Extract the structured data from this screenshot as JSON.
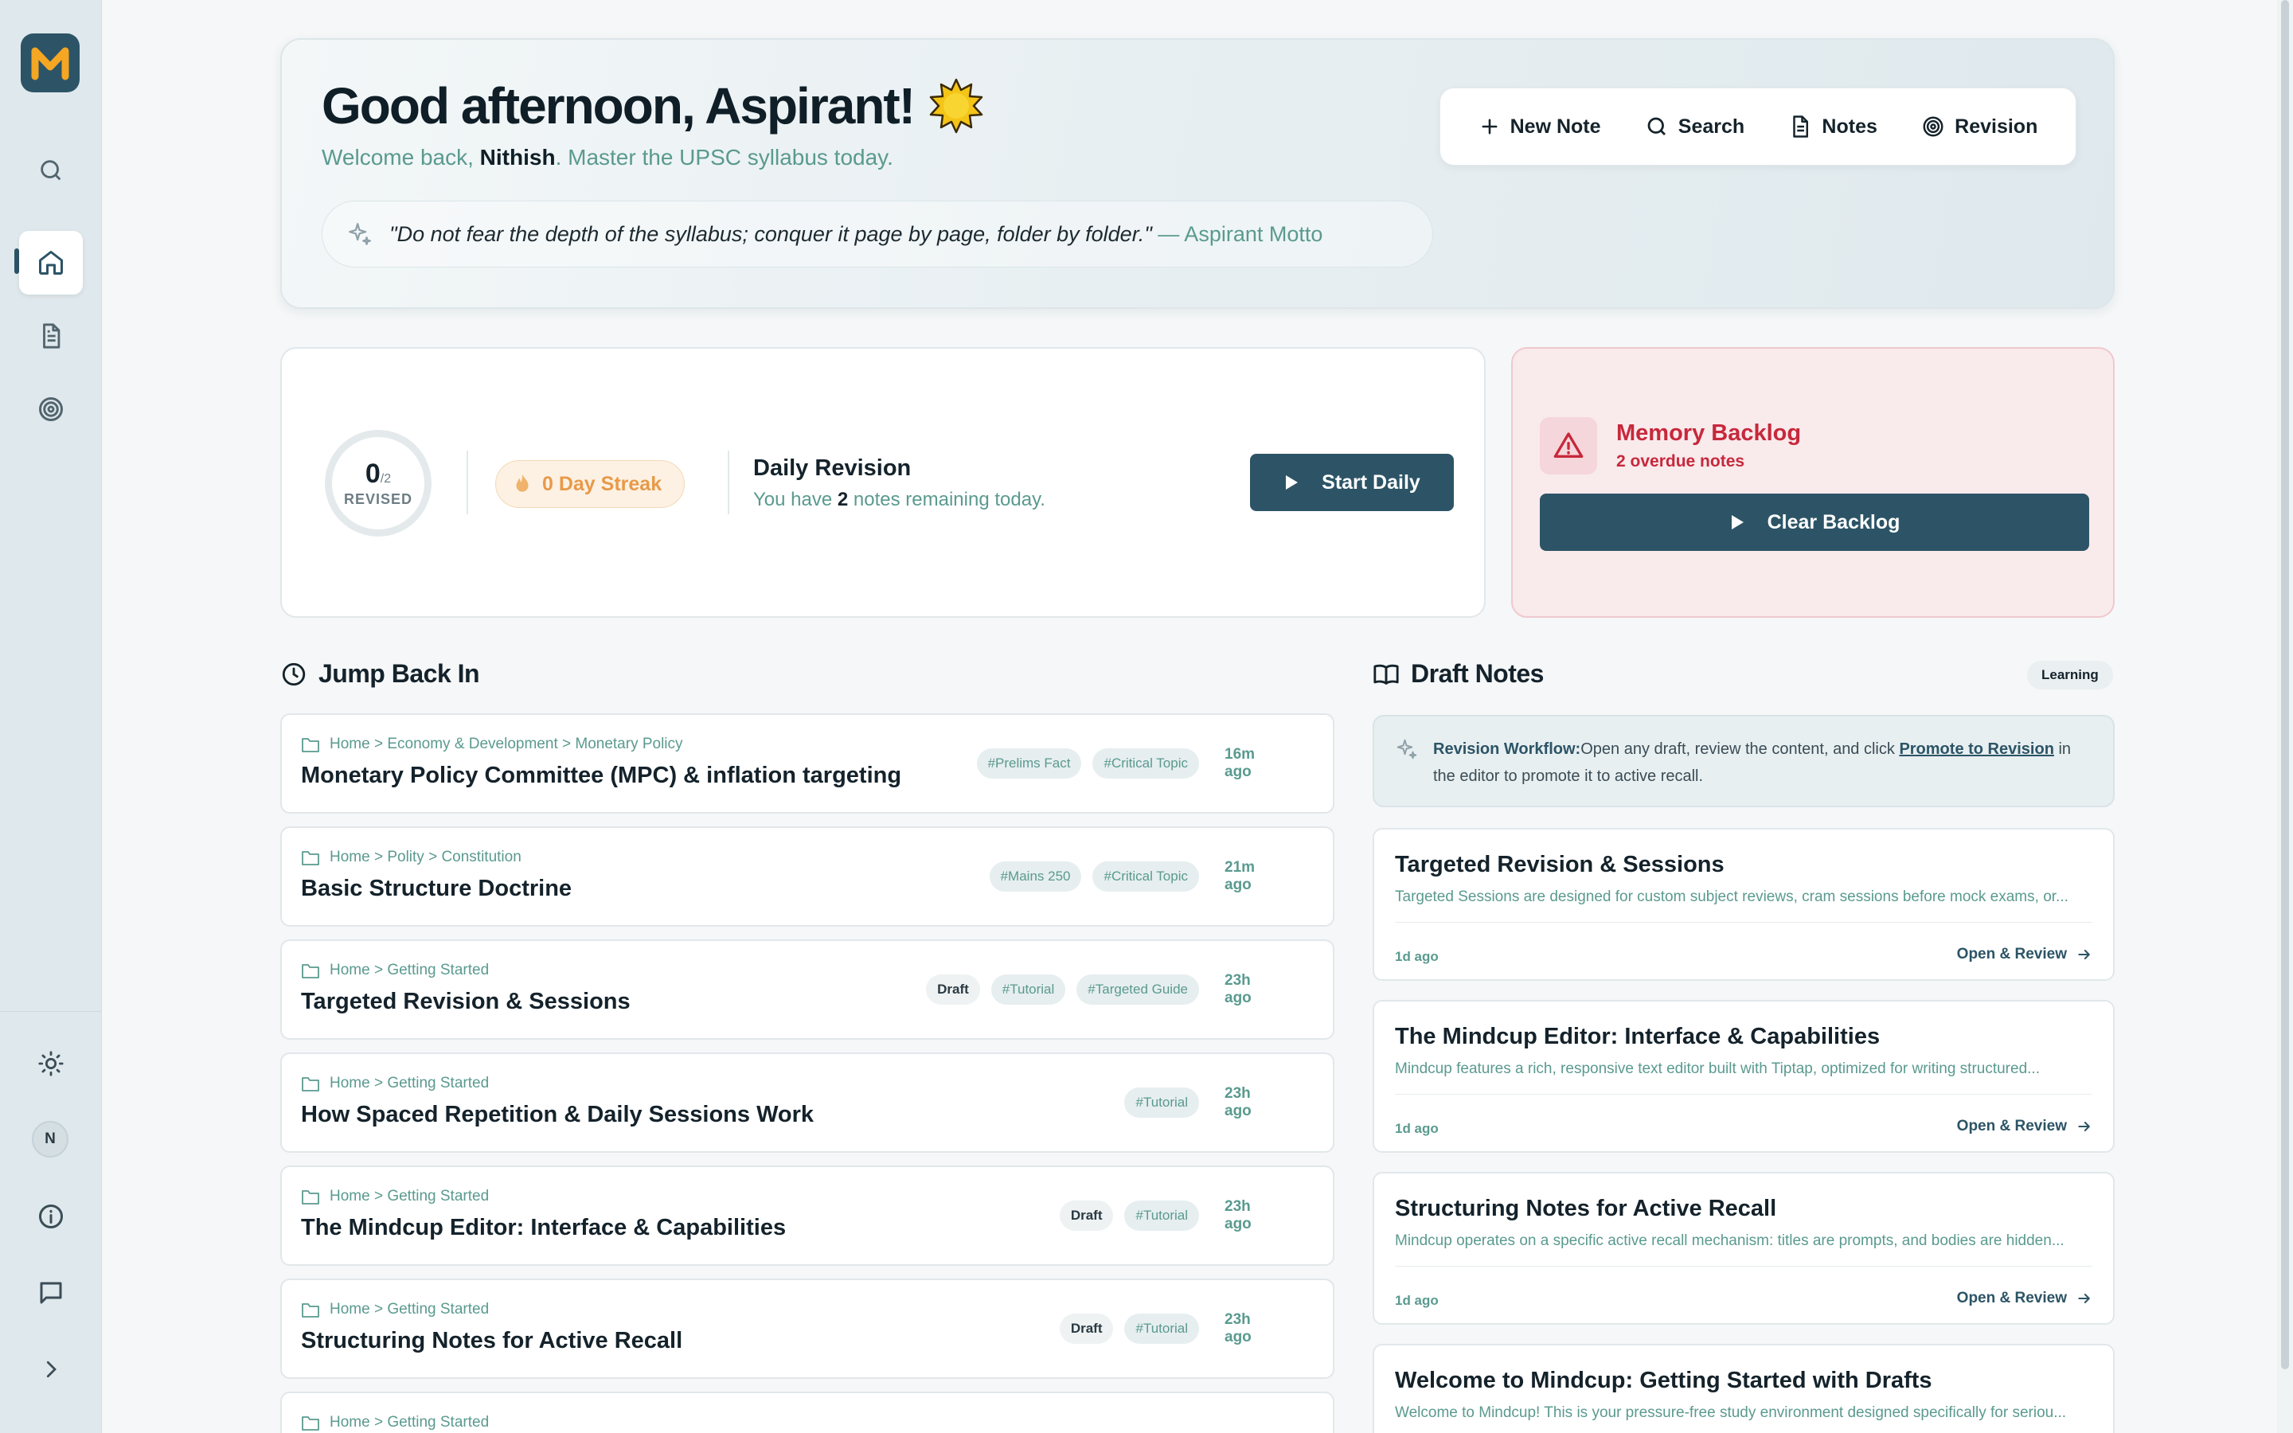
{
  "sidebar": {
    "logo_letter": "M",
    "user_initial": "N"
  },
  "hero": {
    "greeting": "Good afternoon, Aspirant!",
    "welcome_prefix": "Welcome back, ",
    "user_name": "Nithish",
    "welcome_suffix": ". Master the UPSC syllabus today.",
    "quote": "\"Do not fear the depth of the syllabus; conquer it page by page, folder by folder.\"",
    "quote_attribution": "— Aspirant Motto"
  },
  "actions": {
    "new_note": "New Note",
    "search": "Search",
    "notes": "Notes",
    "revision": "Revision"
  },
  "daily": {
    "revised_count": "0",
    "revised_total": "/2",
    "revised_label": "REVISED",
    "streak": "0 Day Streak",
    "title": "Daily Revision",
    "sub_prefix": "You have ",
    "remaining": "2",
    "sub_suffix": " notes remaining today.",
    "start_label": "Start Daily"
  },
  "backlog": {
    "title": "Memory Backlog",
    "subtitle": "2 overdue notes",
    "clear_label": "Clear Backlog"
  },
  "jump_back": {
    "heading": "Jump Back In",
    "rows": [
      {
        "crumb": "Home > Economy & Development > Monetary Policy",
        "title": "Monetary Policy Committee (MPC) & inflation targeting",
        "draft": "",
        "tags": [
          "#Prelims Fact",
          "#Critical Topic"
        ],
        "ago": "16m ago"
      },
      {
        "crumb": "Home > Polity > Constitution",
        "title": "Basic Structure Doctrine",
        "draft": "",
        "tags": [
          "#Mains 250",
          "#Critical Topic"
        ],
        "ago": "21m ago"
      },
      {
        "crumb": "Home > Getting Started",
        "title": "Targeted Revision & Sessions",
        "draft": "Draft",
        "tags": [
          "#Tutorial",
          "#Targeted Guide"
        ],
        "ago": "23h ago"
      },
      {
        "crumb": "Home > Getting Started",
        "title": "How Spaced Repetition & Daily Sessions Work",
        "draft": "",
        "tags": [
          "#Tutorial"
        ],
        "ago": "23h ago"
      },
      {
        "crumb": "Home > Getting Started",
        "title": "The Mindcup Editor: Interface & Capabilities",
        "draft": "Draft",
        "tags": [
          "#Tutorial"
        ],
        "ago": "23h ago"
      },
      {
        "crumb": "Home > Getting Started",
        "title": "Structuring Notes for Active Recall",
        "draft": "Draft",
        "tags": [
          "#Tutorial"
        ],
        "ago": "23h ago"
      },
      {
        "crumb": "Home > Getting Started",
        "title": "",
        "draft": "",
        "tags": [],
        "ago": ""
      }
    ]
  },
  "drafts": {
    "heading": "Draft Notes",
    "badge": "Learning",
    "workflow_label": "Revision Workflow:",
    "workflow_text_1": "Open any draft, review the content, and click ",
    "workflow_link": "Promote to Revision",
    "workflow_text_2": " in the editor to promote it to active recall.",
    "open_label": "Open & Review",
    "cards": [
      {
        "title": "Targeted Revision & Sessions",
        "desc": "Targeted Sessions are designed for custom subject reviews, cram sessions before mock exams, or...",
        "ago": "1d ago"
      },
      {
        "title": "The Mindcup Editor: Interface & Capabilities",
        "desc": "Mindcup features a rich, responsive text editor built with Tiptap, optimized for writing structured...",
        "ago": "1d ago"
      },
      {
        "title": "Structuring Notes for Active Recall",
        "desc": "Mindcup operates on a specific active recall mechanism: titles are prompts, and bodies are hidden...",
        "ago": "1d ago"
      },
      {
        "title": "Welcome to Mindcup: Getting Started with Drafts",
        "desc": "Welcome to Mindcup! This is your pressure-free study environment designed specifically for seriou...",
        "ago": ""
      }
    ]
  },
  "colors": {
    "accent": "#2c5466",
    "teal_text": "#5a9a8f",
    "logo_orange": "#f5a623",
    "danger": "#c7283b",
    "streak": "#e79a4a"
  }
}
